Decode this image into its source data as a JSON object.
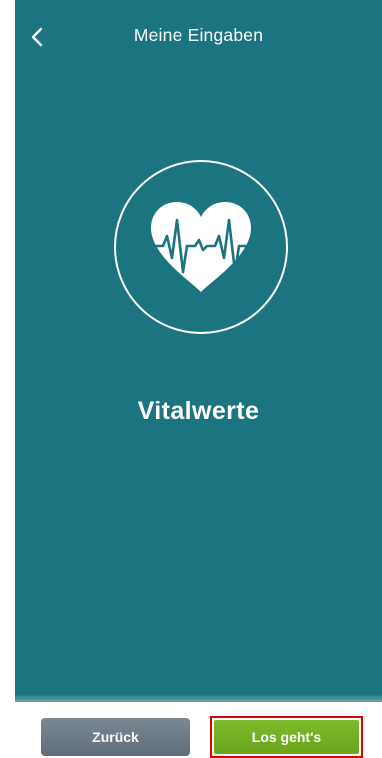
{
  "header": {
    "title": "Meine Eingaben",
    "back_icon": "chevron-left-icon"
  },
  "hero": {
    "icon": "heart-pulse-icon",
    "title": "Vitalwerte"
  },
  "footer": {
    "back_label": "Zurück",
    "go_label": "Los geht's"
  },
  "colors": {
    "panel": "#1b7480",
    "back_button": "#6b7a86",
    "go_button": "#76b023",
    "highlight": "#e00000"
  }
}
